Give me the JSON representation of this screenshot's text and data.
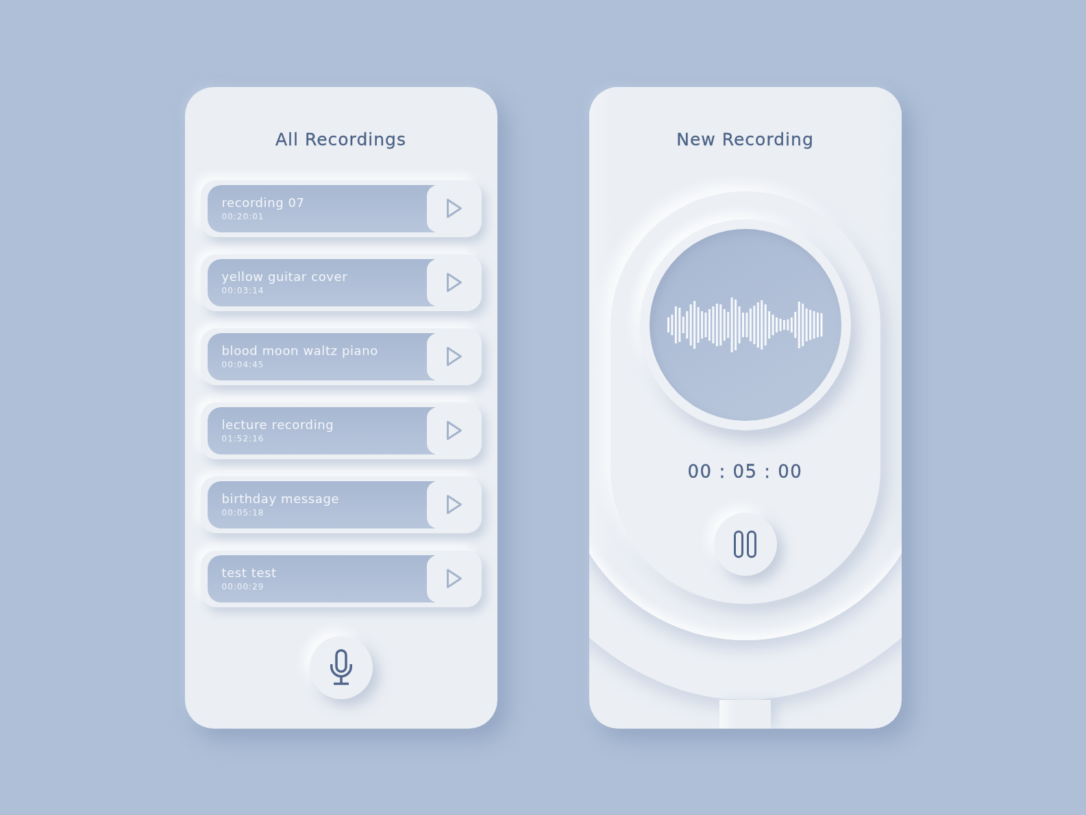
{
  "recordings_panel": {
    "title": "All Recordings",
    "recordings": [
      {
        "name": "recording 07",
        "duration": "00:20:01"
      },
      {
        "name": "yellow guitar cover",
        "duration": "00:03:14"
      },
      {
        "name": "blood moon waltz piano",
        "duration": "00:04:45"
      },
      {
        "name": "lecture recording",
        "duration": "01:52:16"
      },
      {
        "name": "birthday message",
        "duration": "00:05:18"
      },
      {
        "name": "test test",
        "duration": "00:00:29"
      }
    ]
  },
  "new_recording_panel": {
    "title": "New Recording",
    "timer": "00 : 05 : 00"
  }
}
